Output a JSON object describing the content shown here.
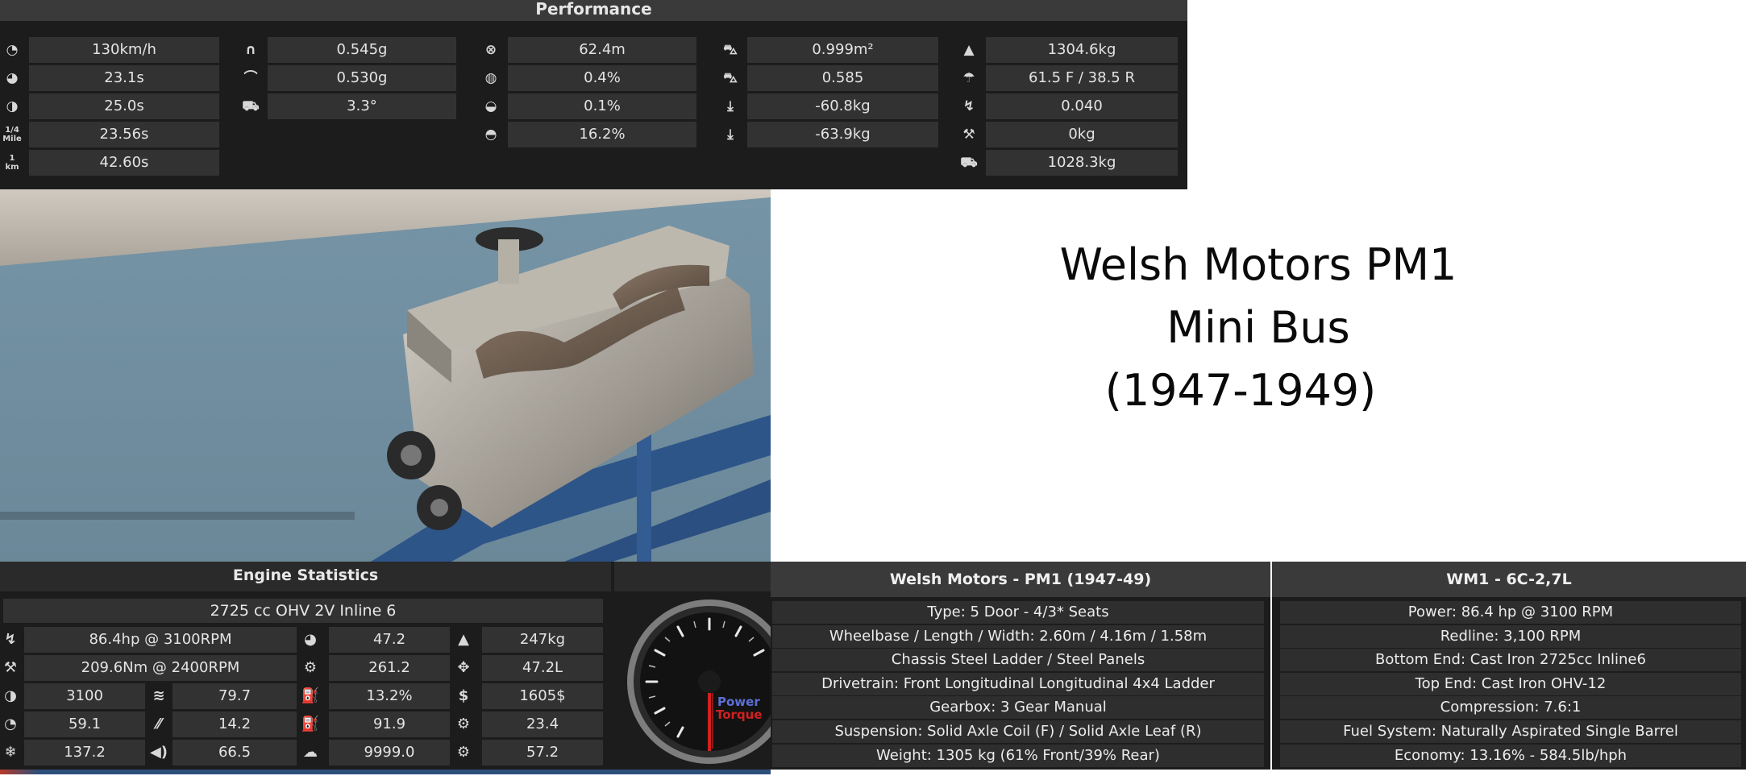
{
  "performance": {
    "title": "Performance",
    "col1": [
      {
        "icon": "top-speed-icon",
        "value": "130km/h"
      },
      {
        "icon": "acceleration-0-100-icon",
        "value": "23.1s"
      },
      {
        "icon": "acceleration-0-160-icon",
        "value": "25.0s"
      },
      {
        "icon": "quarter-mile-icon",
        "icon_text_top": "1/4",
        "icon_text_bottom": "Mile",
        "value": "23.56s"
      },
      {
        "icon": "one-km-icon",
        "icon_text_top": "1",
        "icon_text_bottom": "km",
        "value": "42.60s"
      }
    ],
    "col2": [
      {
        "icon": "cornering-low-speed-icon",
        "value": "0.545g"
      },
      {
        "icon": "cornering-high-speed-icon",
        "value": "0.530g"
      },
      {
        "icon": "body-roll-icon",
        "value": "3.3°"
      }
    ],
    "col3": [
      {
        "icon": "braking-distance-icon",
        "value": "62.4m"
      },
      {
        "icon": "understeer-icon",
        "value": "0.4%"
      },
      {
        "icon": "oversteer-icon",
        "value": "0.1%"
      },
      {
        "icon": "brake-fade-icon",
        "value": "16.2%"
      }
    ],
    "col4": [
      {
        "icon": "frontal-area-icon",
        "value": "0.999m²"
      },
      {
        "icon": "drag-coefficient-icon",
        "value": "0.585"
      },
      {
        "icon": "front-downforce-icon",
        "value": "-60.8kg"
      },
      {
        "icon": "rear-downforce-icon",
        "value": "-63.9kg"
      }
    ],
    "col5": [
      {
        "icon": "weight-icon",
        "value": "1304.6kg"
      },
      {
        "icon": "weight-distribution-icon",
        "value": "61.5 F / 38.5 R"
      },
      {
        "icon": "power-to-weight-icon",
        "value": "0.040"
      },
      {
        "icon": "tuning-weight-icon",
        "value": "0kg"
      },
      {
        "icon": "towing-capacity-icon",
        "value": "1028.3kg"
      }
    ]
  },
  "title_card": {
    "line1": "Welsh Motors PM1",
    "line2": "Mini Bus",
    "line3": "(1947-1949)"
  },
  "engine_stats": {
    "title": "Engine Statistics",
    "subtitle": "2725 cc OHV 2V  Inline 6",
    "power": "86.4hp @ 3100RPM",
    "torque": "209.6Nm @ 2400RPM",
    "redline": "3100",
    "smoothness": "79.7",
    "responsiveness": "59.1",
    "reliability_factor": "14.2",
    "rpm_cooling": "137.2",
    "noise": "66.5",
    "fuel_economy_a": "47.2",
    "efficiency": "261.2",
    "efficiency_pct": "13.2%",
    "fuel_b": "91.9",
    "service_interval": "9999.0",
    "engine_weight": "247kg",
    "displacement_l": "47.2L",
    "cost": "1605$",
    "service_cost": "23.4",
    "reliability": "57.2"
  },
  "gauge": {
    "power_label": "Power",
    "torque_label": "Torque"
  },
  "car_info": {
    "title": "Welsh Motors - PM1 (1947-49)",
    "lines": [
      "Type: 5 Door - 4/3* Seats",
      "Wheelbase / Length / Width: 2.60m / 4.16m / 1.58m",
      "Chassis Steel Ladder / Steel Panels",
      "Drivetrain: Front Longitudinal Longitudinal 4x4 Ladder",
      "Gearbox: 3 Gear Manual",
      "Suspension: Solid Axle Coil (F) / Solid Axle Leaf (R)",
      "Weight: 1305 kg (61% Front/39% Rear)"
    ]
  },
  "engine_info": {
    "title": "WM1 - 6C-2,7L",
    "lines": [
      "Power: 86.4 hp @ 3100 RPM",
      "Redline:  3,100 RPM",
      "Bottom End: Cast Iron 2725cc Inline6",
      "Top End: Cast Iron OHV-12",
      "Compression: 7.6:1",
      "Fuel System: Naturally Aspirated Single Barrel",
      "Economy: 13.16% - 584.5lb/hph"
    ]
  },
  "colors": {
    "panel_bg": "#1c1c1c",
    "cell_bg": "#323232",
    "header_bg": "#3a3a3a",
    "power_color": "#5d6fd6",
    "torque_color": "#d22020"
  }
}
